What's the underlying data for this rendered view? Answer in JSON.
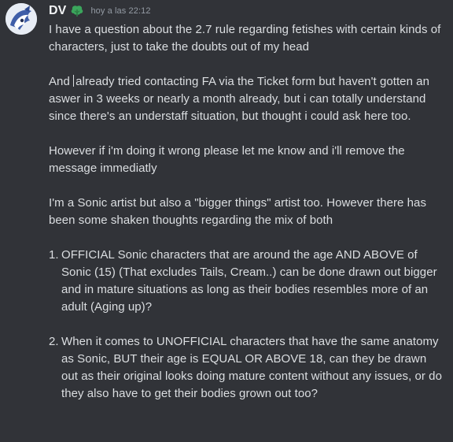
{
  "author": {
    "name": "DV",
    "avatar": "avatar-icon",
    "role_icon": "leaf-role-icon",
    "role_color": "#3ba55c"
  },
  "message": {
    "timestamp": "hoy a las 22:12",
    "paragraphs": [
      "I have a question about the 2.7 rule regarding fetishes with certain kinds of characters, just to take the doubts out of my head",
      "And I already tried contacting FA via the Ticket form but haven't gotten an aswer in 3 weeks or nearly a month already, but i can totally understand since there's an understaff situation, but thought i could ask here too.",
      "However if i'm doing it wrong please let me know and i'll remove the message immediatly",
      "I'm a Sonic artist but also a \"bigger things\" artist too. However there has been some shaken thoughts regarding the mix of both"
    ],
    "paragraph_2_start": "And ",
    "paragraph_2_rest": "already tried contacting FA via the Ticket form but haven't gotten an aswer in 3 weeks or nearly a month already, but i can totally understand since there's an understaff situation, but thought i could ask here too.",
    "list": [
      {
        "number": "1.",
        "text": "OFFICIAL Sonic characters that are around the age AND ABOVE of Sonic (15) (That excludes Tails, Cream..) can be done drawn out bigger and in mature situations as long as their bodies resembles more of an adult (Aging up)?"
      },
      {
        "number": "2.",
        "text": "When it comes to UNOFFICIAL characters that have the same anatomy as Sonic, BUT their age is EQUAL OR ABOVE 18, can they be drawn out as their original looks doing mature content without any issues, or do they also have to get their bodies grown out too?"
      }
    ]
  },
  "colors": {
    "background": "#313338",
    "text": "#dbdee1",
    "username": "#f2f3f5",
    "timestamp": "#949ba4"
  }
}
